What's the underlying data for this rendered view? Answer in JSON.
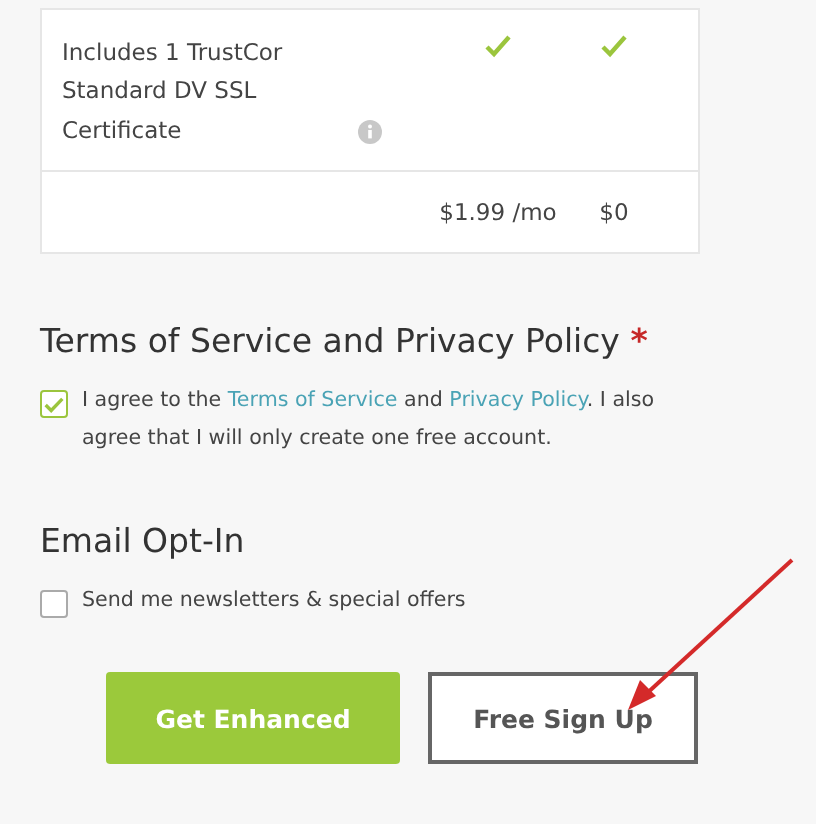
{
  "plan_table": {
    "feature_row": {
      "feature": "Includes 1 TrustCor Standard DV SSL Certificate",
      "columns": [
        {
          "included": true
        },
        {
          "included": true
        }
      ]
    },
    "price_row": {
      "prices": [
        "$1.99 /mo",
        "$0"
      ]
    }
  },
  "terms": {
    "heading": "Terms of Service and Privacy Policy",
    "required_mark": "*",
    "checked": true,
    "text_before": "I agree to the",
    "link_terms": "Terms of Service",
    "text_middle": "and",
    "link_privacy": "Privacy Policy",
    "text_after": ". I also agree that I will only create one free account."
  },
  "email_opt_in": {
    "heading": "Email Opt-In",
    "checked": false,
    "label": "Send me newsletters & special offers"
  },
  "buttons": [
    {
      "kind": "primary",
      "label": "Get Enhanced"
    },
    {
      "kind": "outline",
      "label": "Free Sign Up"
    }
  ]
}
